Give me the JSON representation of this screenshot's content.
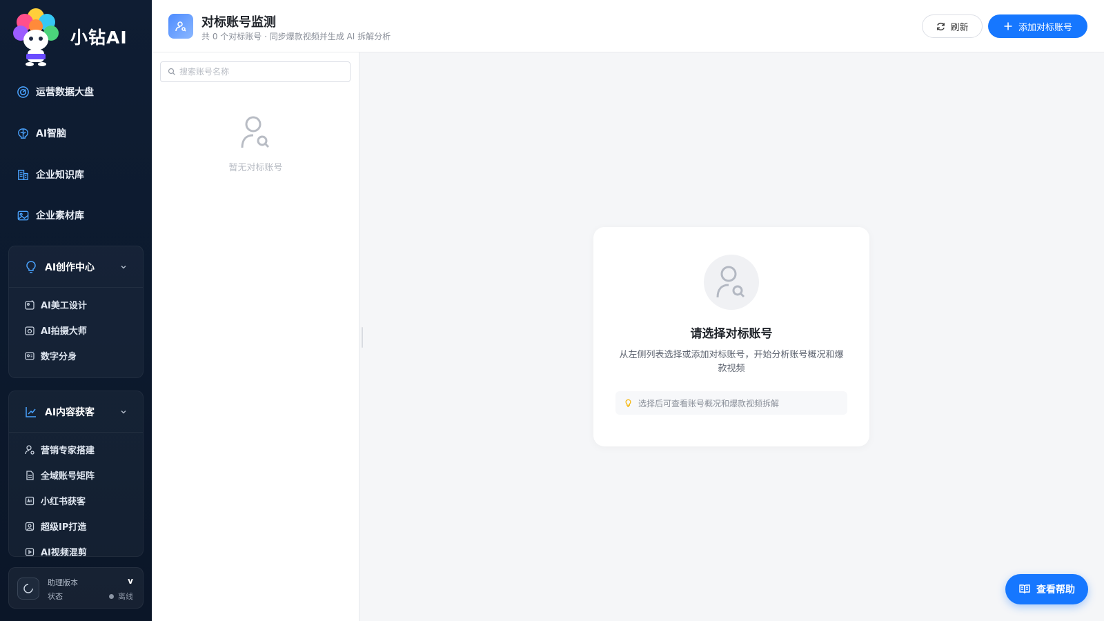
{
  "brand": {
    "name": "小钻AI",
    "badge": "小钻AI"
  },
  "sidebar": {
    "items": [
      {
        "label": "运营数据大盘",
        "icon": "dashboard-icon"
      },
      {
        "label": "AI智脑",
        "icon": "brain-icon"
      },
      {
        "label": "企业知识库",
        "icon": "building-icon"
      },
      {
        "label": "企业素材库",
        "icon": "image-icon"
      }
    ],
    "groups": [
      {
        "label": "AI创作中心",
        "icon": "bulb-icon",
        "expanded": true,
        "items": [
          {
            "label": "AI美工设计",
            "icon": "design-icon"
          },
          {
            "label": "AI拍摄大师",
            "icon": "camera-icon"
          },
          {
            "label": "数字分身",
            "icon": "id-card-icon"
          }
        ]
      },
      {
        "label": "AI内容获客",
        "icon": "trend-icon",
        "expanded": true,
        "items": [
          {
            "label": "营销专家搭建",
            "icon": "user-cog-icon"
          },
          {
            "label": "全域账号矩阵",
            "icon": "file-icon"
          },
          {
            "label": "小红书获客",
            "icon": "ai-box-icon"
          },
          {
            "label": "超级IP打造",
            "icon": "profile-icon"
          },
          {
            "label": "AI视频混剪",
            "icon": "video-icon"
          }
        ]
      }
    ],
    "status": {
      "version_label": "助理版本",
      "version_value": "v",
      "status_label": "状态",
      "status_value": "离线"
    }
  },
  "header": {
    "title": "对标账号监测",
    "subtitle": "共 0 个对标账号 · 同步爆款视频并生成 AI 拆解分析",
    "refresh_label": "刷新",
    "add_label": "添加对标账号"
  },
  "list": {
    "search_placeholder": "搜索账号名称",
    "search_value": "",
    "empty_text": "暂无对标账号"
  },
  "main": {
    "empty_title": "请选择对标账号",
    "empty_desc": "从左侧列表选择或添加对标账号，开始分析账号概况和爆款视频",
    "tip": "选择后可查看账号概况和爆款视频拆解"
  },
  "help": {
    "label": "查看帮助"
  },
  "colors": {
    "accent": "#1677ff",
    "sidebar_bg": "#0f1d33",
    "offline": "#8b95a4"
  }
}
